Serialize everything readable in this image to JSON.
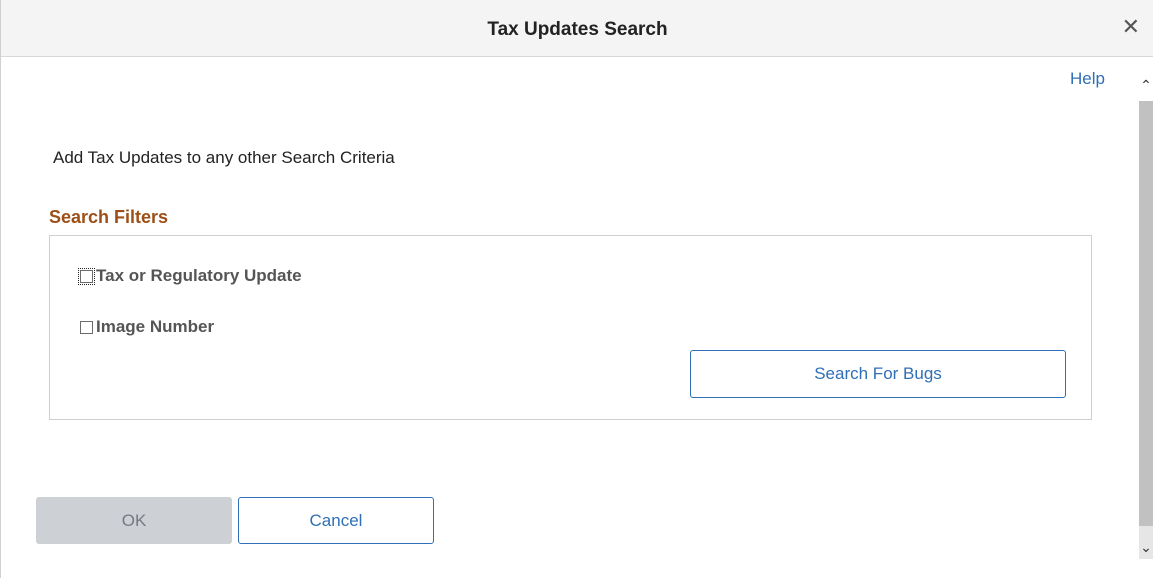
{
  "modal": {
    "title": "Tax Updates Search",
    "close_icon": "close-icon",
    "help_label": "Help"
  },
  "content": {
    "intro_text": "Add Tax Updates to any other Search Criteria",
    "section_title": "Search Filters",
    "filters": [
      {
        "label": "Tax or Regulatory Update",
        "checked": false
      },
      {
        "label": "Image Number",
        "checked": false
      }
    ],
    "search_button_label": "Search For Bugs"
  },
  "footer": {
    "ok_label": "OK",
    "ok_disabled": true,
    "cancel_label": "Cancel"
  },
  "colors": {
    "accent": "#2f6fb5",
    "section_title": "#9c4f16",
    "disabled_bg": "#cdd0d4"
  }
}
